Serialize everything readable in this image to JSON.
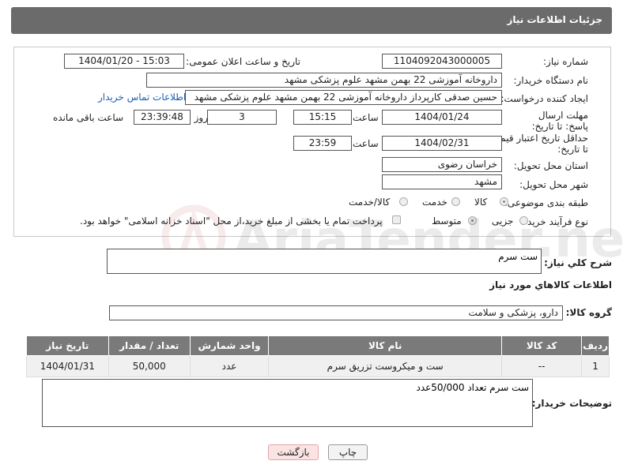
{
  "header": {
    "title": "جزئیات اطلاعات نیاز"
  },
  "fields": {
    "need_number_label": "شماره نیاز:",
    "need_number": "1104092043000005",
    "announce_label": "تاریخ و ساعت اعلان عمومی:",
    "announce_value": "1404/01/20 - 15:03",
    "buyer_org_label": "نام دستگاه خریدار:",
    "buyer_org": "داروخانه آموزشی 22 بهمن مشهد   علوم پزشکی مشهد",
    "creator_label": "ایجاد کننده درخواست:",
    "creator": "حسین صدقی کارپرداز داروخانه آموزشی 22 بهمن مشهد   علوم پزشکی مشهد",
    "contact_link": "اطلاعات تماس خریدار",
    "deadline_label": "مهلت ارسال پاسخ: تا تاریخ:",
    "deadline_date": "1404/01/24",
    "time_label": "ساعت",
    "deadline_time": "15:15",
    "days_value": "3",
    "days_label": "روز و",
    "remaining_time": "23:39:48",
    "remaining_label": "ساعت باقی مانده",
    "validity_label": "حداقل تاریخ اعتبار قیمت: تا تاریخ:",
    "validity_date": "1404/02/31",
    "validity_time": "23:59",
    "province_label": "استان محل تحویل:",
    "province": "خراسان رضوی",
    "city_label": "شهر محل تحویل:",
    "city": "مشهد",
    "category_label": "طبقه بندی موضوعی:",
    "category_options": [
      "کالا",
      "خدمت",
      "کالا/خدمت"
    ],
    "process_label": "نوع فرآیند خرید :",
    "process_options": [
      "جزیی",
      "متوسط"
    ],
    "payment_note": "پرداخت تمام یا بخشی از مبلغ خرید،از محل \"اسناد خزانه اسلامی\" خواهد بود."
  },
  "summary": {
    "label": "شرح کلي نياز:",
    "value": "ست سرم"
  },
  "goods_section": {
    "title": "اطلاعات کالاهاي مورد نياز",
    "group_label": "گروه کالا:",
    "group_value": "دارو، پزشکی و سلامت"
  },
  "table": {
    "headers": [
      "ردیف",
      "کد کالا",
      "نام کالا",
      "واحد شمارش",
      "تعداد / مقدار",
      "تاریخ نیاز"
    ],
    "rows": [
      [
        "1",
        "--",
        "ست و میکروست تزریق سرم",
        "عدد",
        "50,000",
        "1404/01/31"
      ]
    ]
  },
  "buyer_notes": {
    "label": "توضیحات خریدار:",
    "value": "ست سرم تعداد 50/000عدد"
  },
  "buttons": {
    "print": "چاپ",
    "back": "بازگشت"
  },
  "watermark": {
    "text": "AriaTender.neT"
  }
}
